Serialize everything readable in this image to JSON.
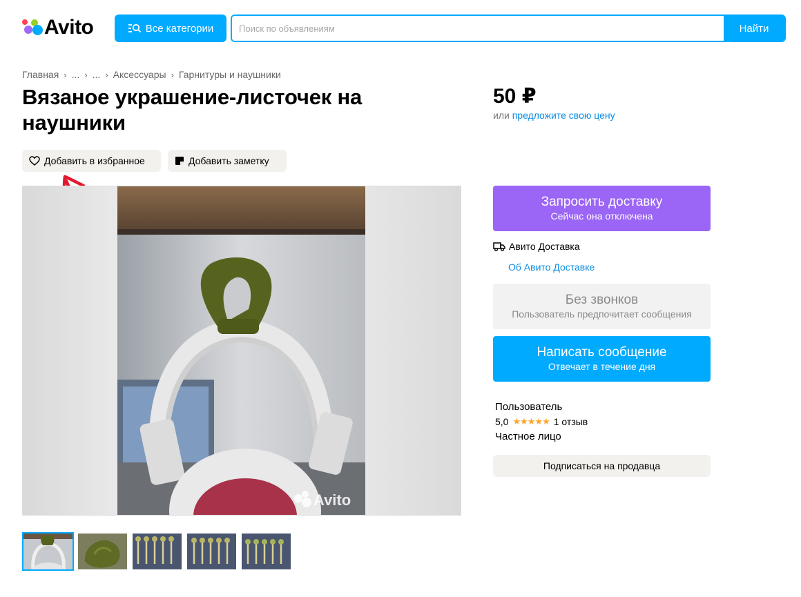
{
  "header": {
    "logo_text": "Avito",
    "categories_button": "Все категории",
    "search_placeholder": "Поиск по объявлениям",
    "search_button": "Найти"
  },
  "breadcrumbs": [
    "Главная",
    "...",
    "...",
    "Аксессуары",
    "Гарнитуры и наушники"
  ],
  "listing": {
    "title": "Вязаное украшение-листочек на наушники",
    "favorite_button": "Добавить в избранное",
    "note_button": "Добавить заметку",
    "image_watermark": "Avito",
    "thumbnails_count": 5
  },
  "price": {
    "value": "50 ₽",
    "prefix": "или",
    "offer_link": "предложите свою цену"
  },
  "actions": {
    "delivery_title": "Запросить доставку",
    "delivery_sub": "Сейчас она отключена",
    "delivery_label": "Авито Доставка",
    "delivery_link": "Об Авито Доставке",
    "no_calls_title": "Без звонков",
    "no_calls_sub": "Пользователь предпочитает сообщения",
    "message_title": "Написать сообщение",
    "message_sub": "Отвечает в течение дня"
  },
  "seller": {
    "name": "Пользователь",
    "rating": "5,0",
    "stars": 5,
    "reviews": "1 отзыв",
    "type": "Частное лицо",
    "subscribe": "Подписаться на продавца"
  },
  "colors": {
    "accent_blue": "#00aaff",
    "link_blue": "#0a8de3",
    "delivery_purple": "#9b65f5",
    "pill_bg": "#f2f1ed",
    "star": "#ffa62b",
    "annotation_red": "#e3182e"
  }
}
